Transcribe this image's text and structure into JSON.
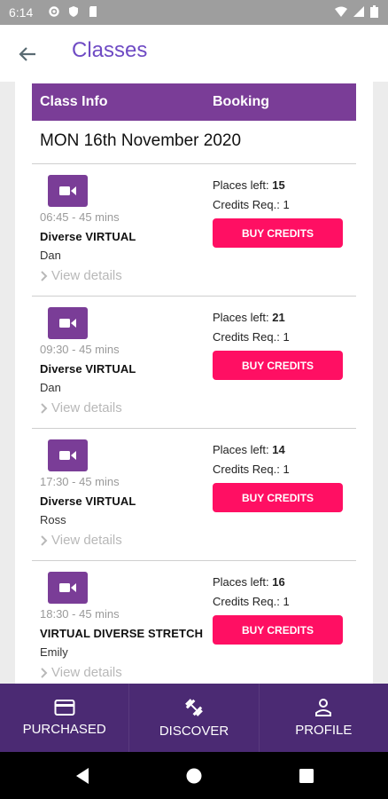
{
  "status_bar": {
    "time": "6:14"
  },
  "app_bar": {
    "title": "Classes"
  },
  "table": {
    "col_info": "Class Info",
    "col_booking": "Booking"
  },
  "date_heading": "MON 16th November 2020",
  "classes": [
    {
      "time": "06:45 - 45 mins",
      "name": "Diverse VIRTUAL",
      "instructor": "Dan",
      "details_label": "View details",
      "places_label": "Places left:",
      "places": "15",
      "credits_label": "Credits Req.:",
      "credits": "1",
      "buy_label": "BUY CREDITS"
    },
    {
      "time": "09:30 - 45 mins",
      "name": "Diverse VIRTUAL",
      "instructor": "Dan",
      "details_label": "View details",
      "places_label": "Places left:",
      "places": "21",
      "credits_label": "Credits Req.:",
      "credits": "1",
      "buy_label": "BUY CREDITS"
    },
    {
      "time": "17:30 - 45 mins",
      "name": "Diverse VIRTUAL",
      "instructor": "Ross",
      "details_label": "View details",
      "places_label": "Places left:",
      "places": "14",
      "credits_label": "Credits Req.:",
      "credits": "1",
      "buy_label": "BUY CREDITS"
    },
    {
      "time": "18:30 - 45 mins",
      "name": "VIRTUAL DIVERSE STRETCH",
      "instructor": "Emily",
      "details_label": "View details",
      "places_label": "Places left:",
      "places": "16",
      "credits_label": "Credits Req.:",
      "credits": "1",
      "buy_label": "BUY CREDITS"
    }
  ],
  "bottom_nav": [
    {
      "label": "PURCHASED",
      "icon": "credit-card-icon"
    },
    {
      "label": "DISCOVER",
      "icon": "dumbbell-icon"
    },
    {
      "label": "PROFILE",
      "icon": "person-icon"
    }
  ],
  "colors": {
    "accent": "#7a3d97",
    "title": "#6f4bc4",
    "buy": "#ff0f63",
    "nav_bg": "#4b2a73"
  }
}
